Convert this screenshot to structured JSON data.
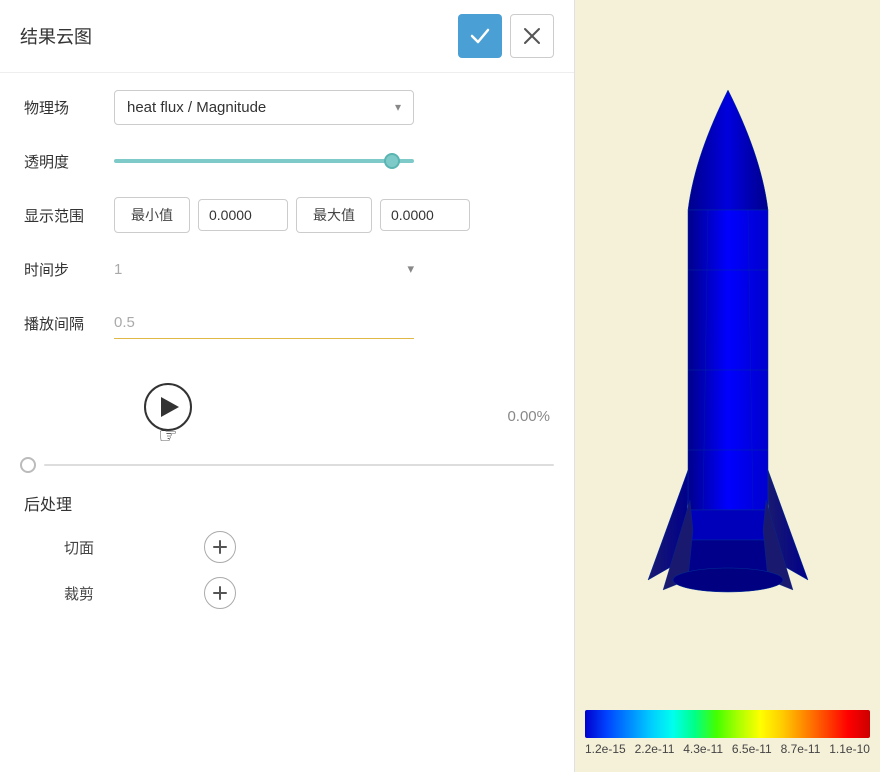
{
  "header": {
    "title": "结果云图",
    "confirm_label": "✓",
    "close_label": "✕"
  },
  "form": {
    "physics_field_label": "物理场",
    "physics_field_value": "heat flux / Magnitude",
    "transparency_label": "透明度",
    "transparency_value": 95,
    "display_range_label": "显示范围",
    "min_label": "最小值",
    "min_value": "0.0000",
    "max_label": "最大值",
    "max_value": "0.0000",
    "time_step_label": "时间步",
    "time_step_value": "1",
    "interval_label": "播放间隔",
    "interval_value": "0.5",
    "progress_percent": "0.00%"
  },
  "post_processing": {
    "title": "后处理",
    "section_label": "切面",
    "clip_label": "裁剪"
  },
  "color_bar": {
    "labels": [
      "1.2e-15",
      "2.2e-11",
      "4.3e-11",
      "6.5e-11",
      "8.7e-11",
      "1.1e-10"
    ]
  }
}
